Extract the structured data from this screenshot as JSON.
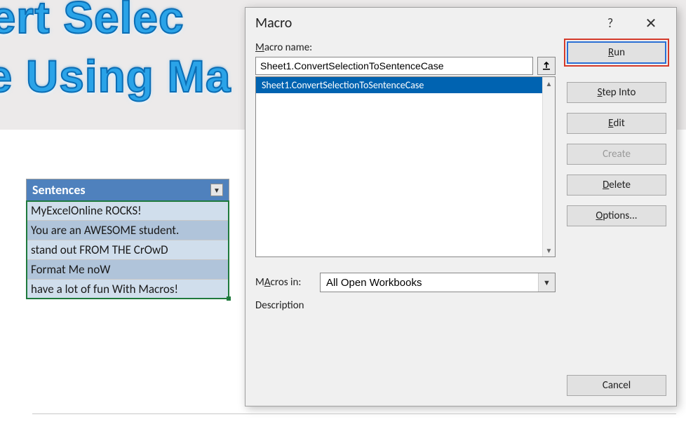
{
  "background": {
    "title_line1": "nvert Selec",
    "title_line2": "se Using Ma"
  },
  "table": {
    "header": "Sentences",
    "rows": [
      "MyExcelOnline ROCKS!",
      "You are an AWESOME student.",
      "stand out FROM THE CrOwD",
      "Format Me noW",
      "have a lot of fun With Macros!"
    ]
  },
  "dialog": {
    "title": "Macro",
    "help_icon": "?",
    "close_icon": "✕",
    "labels": {
      "macro_name_pre": "M",
      "macro_name_post": "acro name:",
      "macros_in": "Macros in:",
      "macros_in_ul": "A",
      "description": "Description"
    },
    "macro_name_value": "Sheet1.ConvertSelectionToSentenceCase",
    "list": [
      "Sheet1.ConvertSelectionToSentenceCase"
    ],
    "macros_in_value": "All Open Workbooks",
    "buttons": {
      "run_ul": "R",
      "run_post": "un",
      "stepinto_ul": "S",
      "stepinto_post": "tep Into",
      "edit_ul": "E",
      "edit_post": "dit",
      "create": "Create",
      "delete_ul": "D",
      "delete_post": "elete",
      "options_ul": "O",
      "options_post": "ptions...",
      "cancel": "Cancel"
    }
  }
}
